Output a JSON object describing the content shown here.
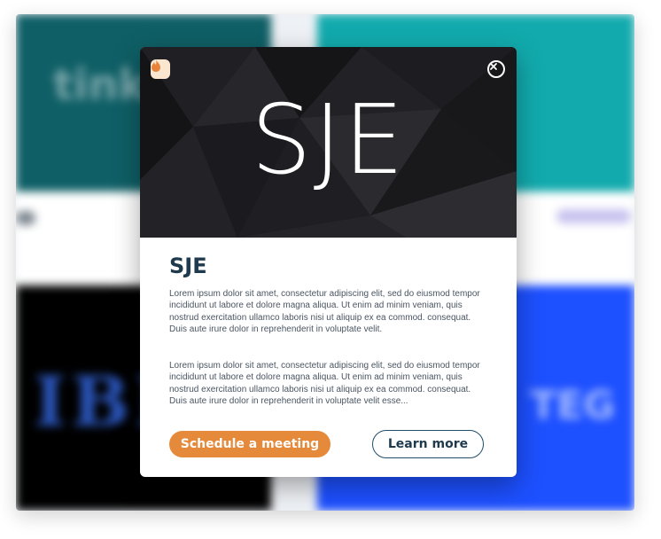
{
  "background": {
    "cards": {
      "top_left_text": "tink",
      "top_right_text": "",
      "bottom_left_text": "IBI",
      "bottom_right_text": "TEG"
    }
  },
  "modal": {
    "hero_title": "SJE",
    "heading": "SJE",
    "paragraph_1": "Lorem ipsum dolor sit amet, consectetur adipiscing elit, sed do eiusmod tempor incididunt ut labore et dolore magna aliqua. Ut enim ad minim veniam, quis nostrud exercitation ullamco laboris nisi ut aliquip ex ea commod. consequat. Duis aute irure dolor in reprehenderit in voluptate velit.",
    "paragraph_2": "Lorem ipsum dolor sit amet, consectetur adipiscing elit, sed do eiusmod tempor incididunt ut labore et dolore magna aliqua. Ut enim ad minim veniam, quis nostrud exercitation ullamco laboris nisi ut aliquip ex ea commod. consequat. Duis aute irure dolor in reprehenderit in voluptate velit esse...",
    "primary_button": "Schedule a meeting",
    "secondary_button": "Learn more",
    "icons": {
      "brand": "flame-badge-icon",
      "close": "close-circle-icon"
    }
  },
  "colors": {
    "accent_orange": "#e58a3a",
    "heading_navy": "#1f3a4d",
    "hero_dark": "#1a1a1d",
    "teal_dark": "#0f5f66",
    "teal_light": "#12aaad",
    "blue": "#1d50ff"
  }
}
